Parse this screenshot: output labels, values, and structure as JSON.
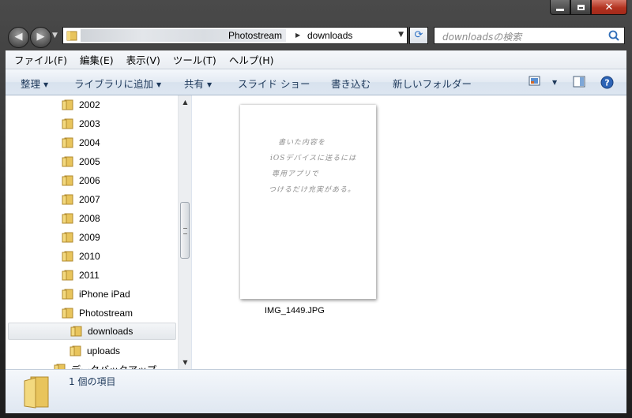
{
  "window": {
    "caption_buttons": [
      "minimize",
      "maximize",
      "close"
    ]
  },
  "address_bar": {
    "crumbs": [
      "Photostream",
      "downloads"
    ]
  },
  "search": {
    "placeholder": "downloadsの検索"
  },
  "menu": {
    "items": [
      "ファイル(F)",
      "編集(E)",
      "表示(V)",
      "ツール(T)",
      "ヘルプ(H)"
    ]
  },
  "toolbar": {
    "organize": "整理",
    "library": "ライブラリに追加",
    "share": "共有",
    "slideshow": "スライド ショー",
    "burn": "書き込む",
    "new_folder": "新しいフォルダー"
  },
  "tree": {
    "items": [
      "2002",
      "2003",
      "2004",
      "2005",
      "2006",
      "2007",
      "2008",
      "2009",
      "2010",
      "2011",
      "iPhone iPad",
      "Photostream",
      "downloads",
      "uploads",
      "データバックアップ"
    ],
    "selected": "downloads"
  },
  "file": {
    "name": "IMG_1449.JPG",
    "handwriting": [
      "書いた内容を",
      "iOSデバイスに送るには",
      "専用アプリで",
      "つけるだけ充実がある。"
    ]
  },
  "status": {
    "item_count": "1 個の項目"
  },
  "colors": {
    "frame": "#2a2a2a",
    "toolbar_text": "#1e395b",
    "folder": "#e8c45c",
    "close_button": "#b33320"
  }
}
